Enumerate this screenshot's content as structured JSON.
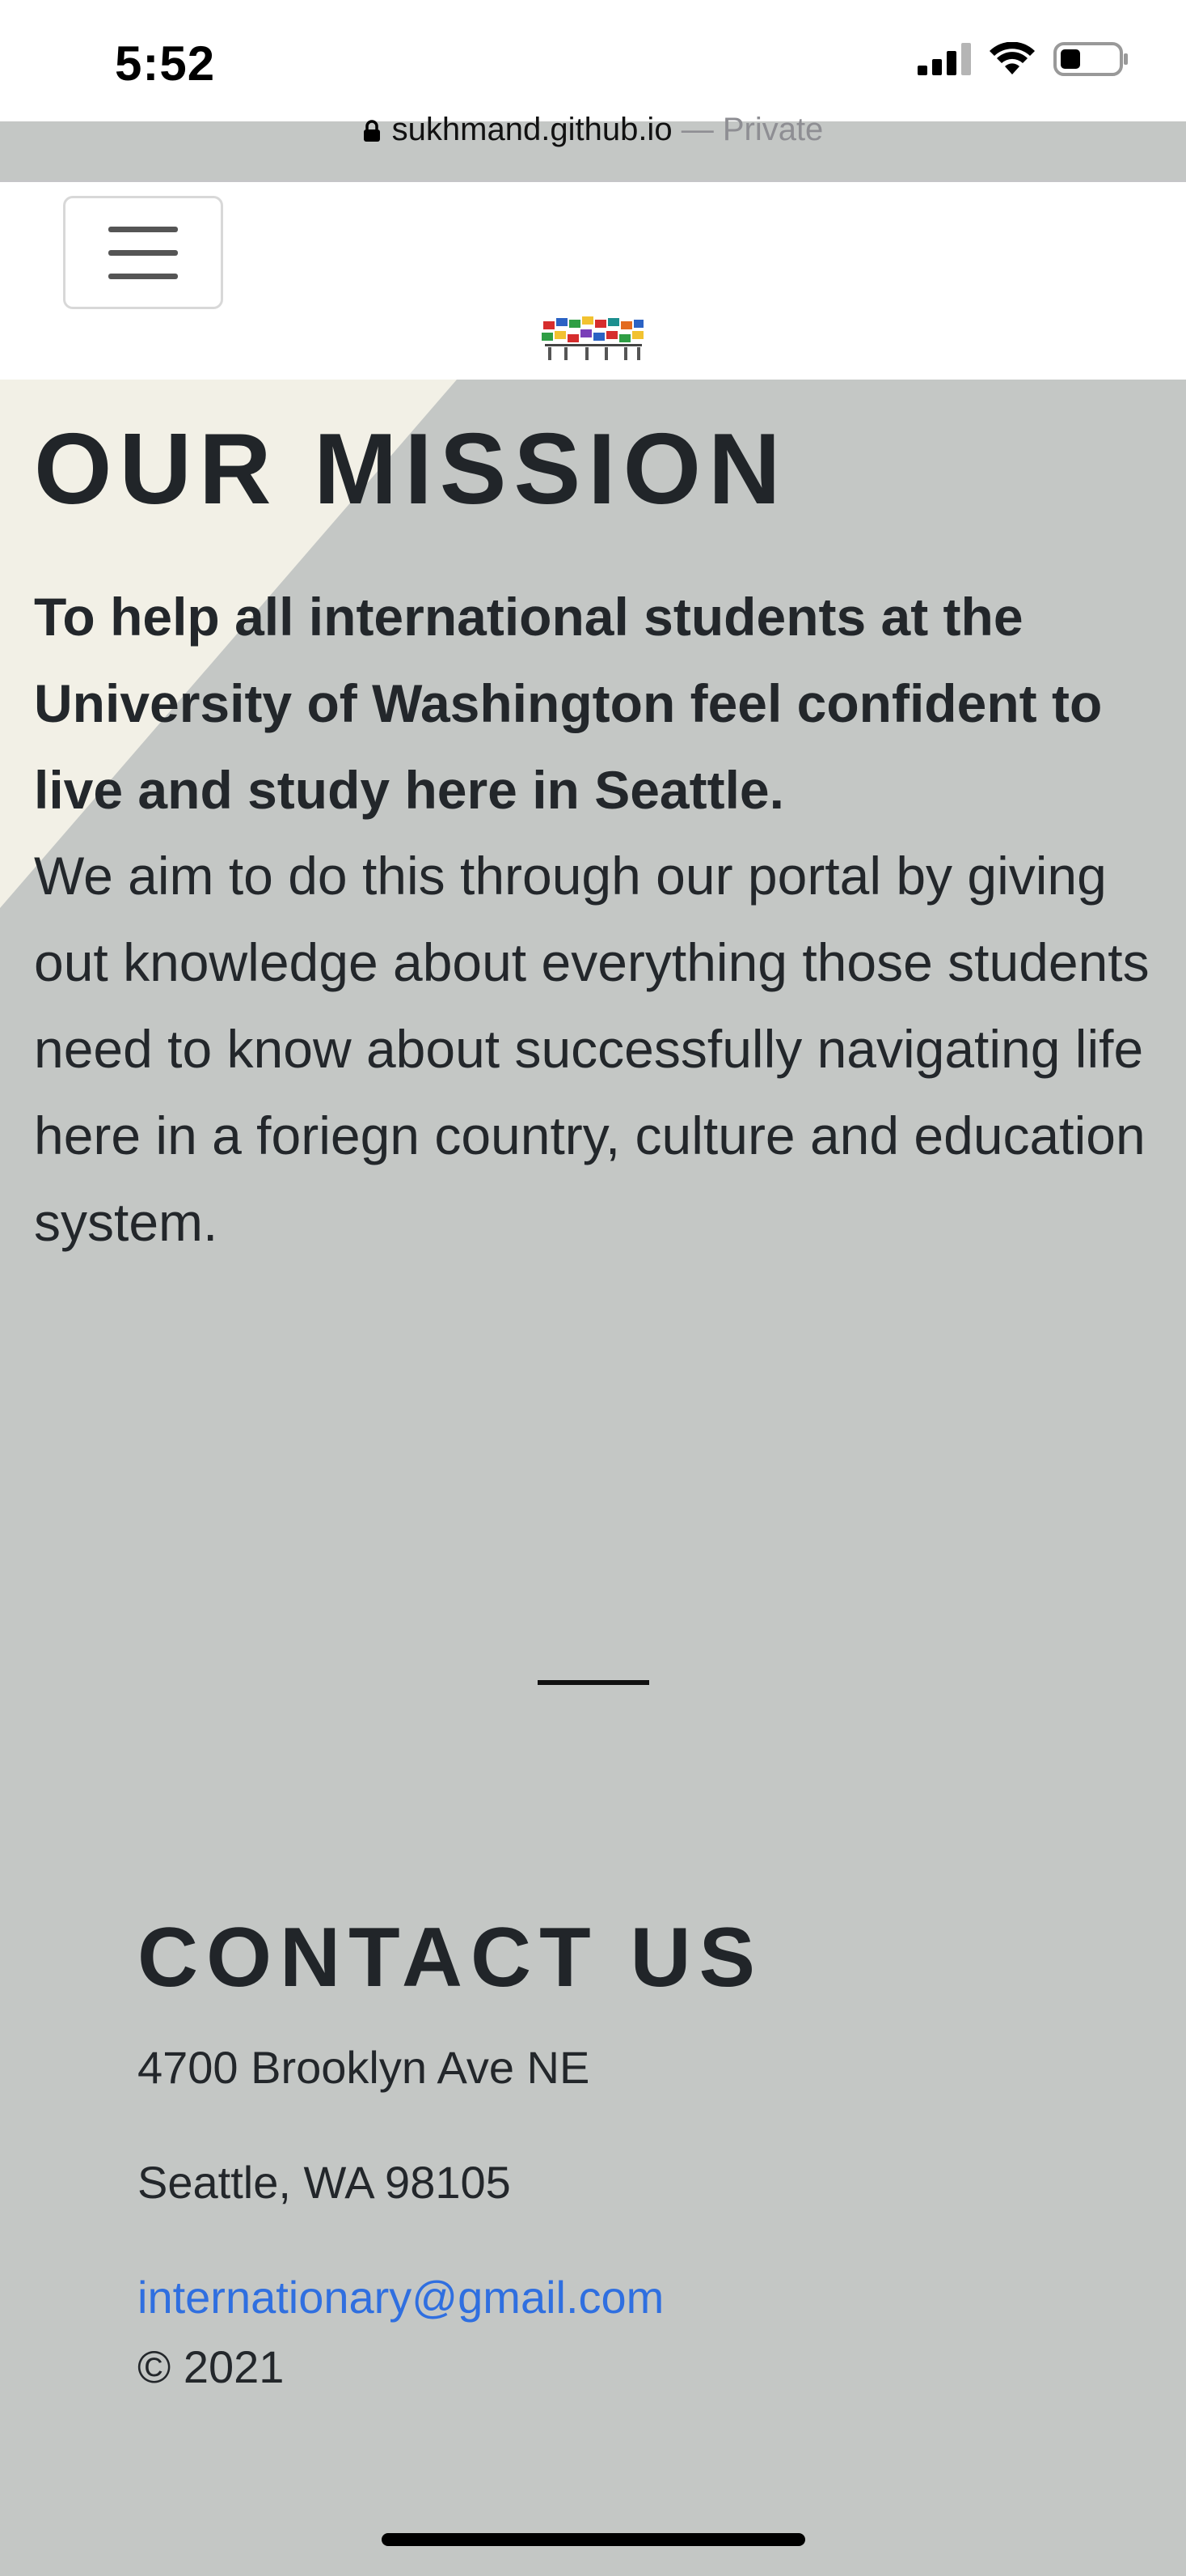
{
  "status_bar": {
    "time": "5:52",
    "icons": [
      "signal-icon",
      "wifi-icon",
      "battery-icon"
    ]
  },
  "browser": {
    "domain": "sukhmand.github.io",
    "separator": " — ",
    "mode": "Private"
  },
  "navbar": {
    "menu_icon": "hamburger-menu-icon",
    "logo": "flags-logo"
  },
  "mission": {
    "title": "OUR MISSION",
    "lead": "To help all international students at the University of Washington feel confident to live and study here in Seattle.",
    "body": "We aim to do this through our portal by giving out knowledge about everything those students need to know about successfully navigating life here in a foriegn country, culture and education system."
  },
  "contact": {
    "title": "CONTACT US",
    "address_line1": "4700 Brooklyn Ave NE",
    "address_line2": "Seattle, WA 98105",
    "email": "internationary@gmail.com",
    "copyright": "© 2021"
  },
  "colors": {
    "section_bg": "#c4c7c5",
    "accent_triangle": "#f2f0e6",
    "link": "#2f6fe0",
    "text": "#23272b"
  }
}
